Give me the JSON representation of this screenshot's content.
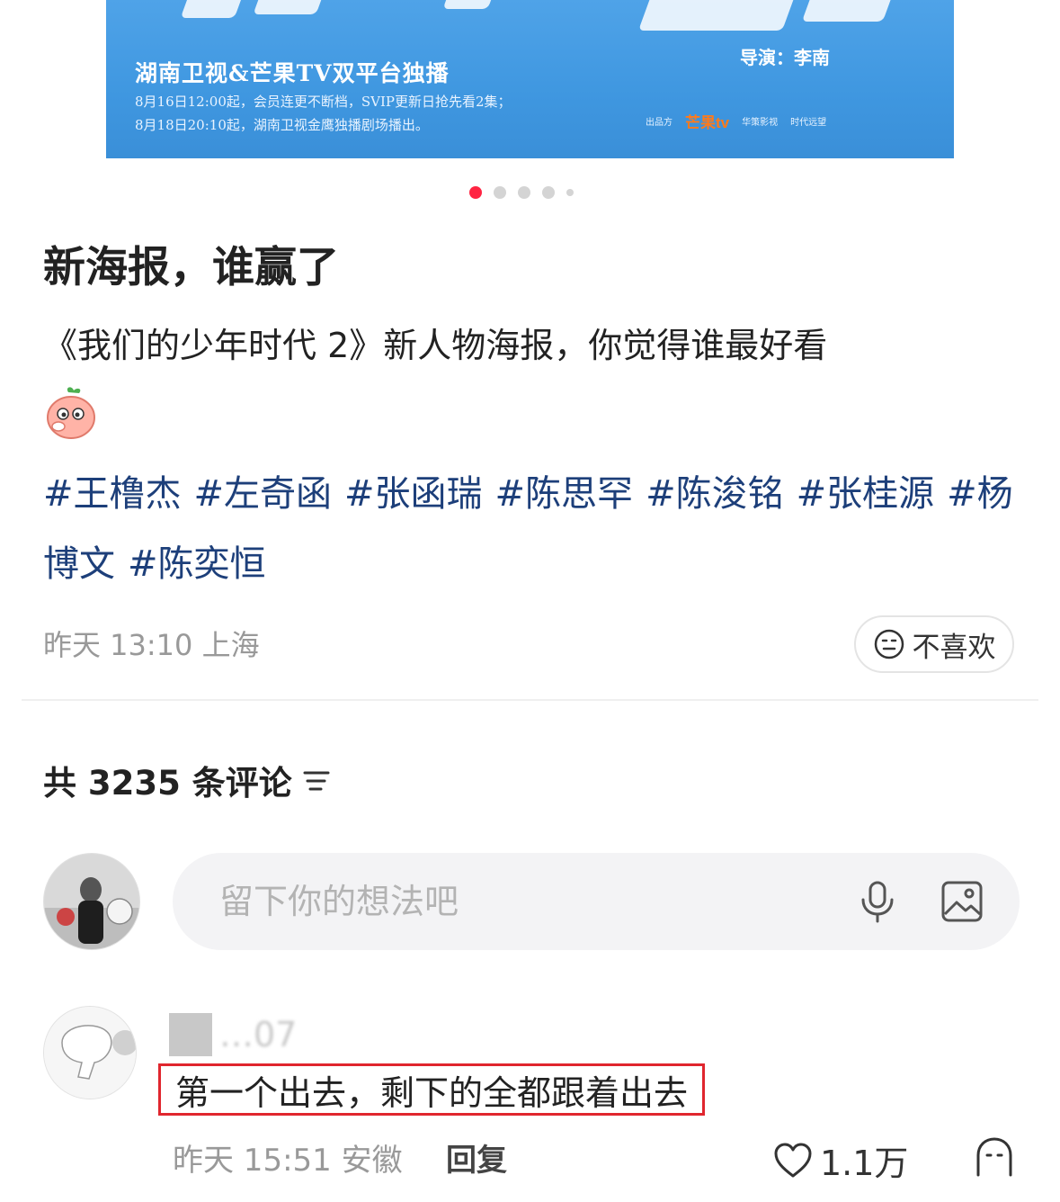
{
  "banner": {
    "title": "湖南卫视&芒果TV双平台独播",
    "line1": "8月16日12:00起，会员连更不断档，SVIP更新日抢先看2集；",
    "line2": "8月18日20:10起，湖南卫视金鹰独播剧场播出。",
    "director": "导演：李南",
    "credits_label": "出品方",
    "credit_logos": [
      "芒果tv",
      "华策影视",
      "时代远望"
    ],
    "carousel_total": 5,
    "carousel_active": 1
  },
  "post": {
    "title": "新海报，谁赢了",
    "description": "《我们的少年时代 2》新人物海报，你觉得谁最好看",
    "emoji": "peach-blush-emoji",
    "tags": [
      "#王橹杰",
      "#左奇函",
      "#张函瑞",
      "#陈思罕",
      "#陈浚铭",
      "#张桂源",
      "#杨博文",
      "#陈奕恒"
    ],
    "meta": "昨天 13:10 上海",
    "dislike_label": "不喜欢"
  },
  "comments": {
    "count_label": "共 3235 条评论",
    "input_placeholder": "留下你的想法吧",
    "items": [
      {
        "username": "…07",
        "text": "第一个出去，剩下的全都跟着出去",
        "meta": "昨天 15:51 安徽",
        "reply_label": "回复",
        "likes": "1.1万"
      }
    ]
  },
  "colors": {
    "accent": "#ff2442",
    "tag_link": "#1d3f7a",
    "highlight_border": "#e0262e",
    "banner_bg": "#3f97e0"
  }
}
